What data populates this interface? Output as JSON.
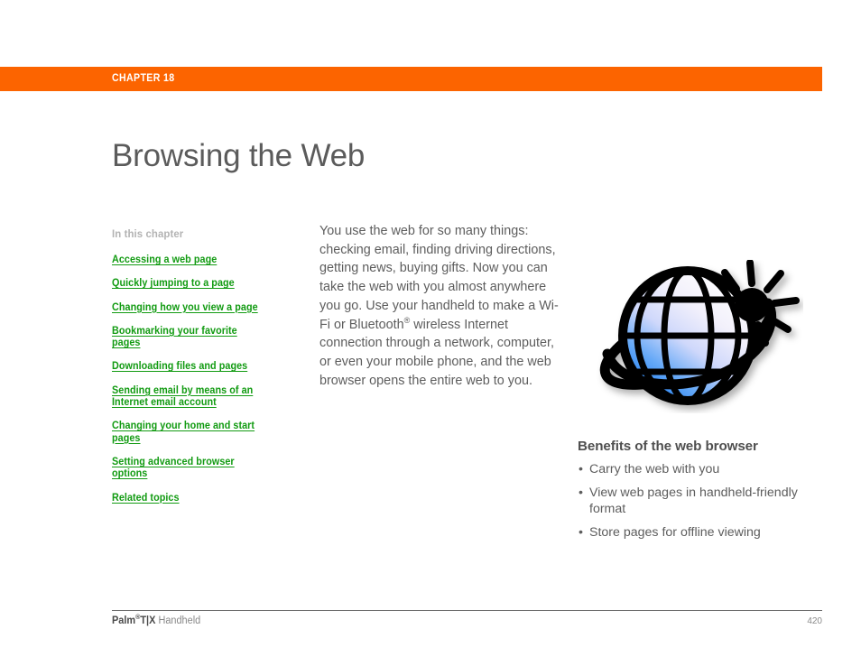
{
  "chapter": {
    "band_color": "#fc6400",
    "label": "CHAPTER 18"
  },
  "title": "Browsing the Web",
  "sidebar": {
    "heading": "In this chapter",
    "link_color": "#129b12",
    "links": [
      "Accessing a web page",
      "Quickly jumping to a page",
      "Changing how you view a page",
      "Bookmarking your favorite pages",
      "Downloading files and pages",
      "Sending email by means of an Internet email account",
      "Changing your home and start pages",
      "Setting advanced browser options",
      "Related topics"
    ]
  },
  "body": {
    "paragraph_part1": "You use the web for so many things: checking email, finding driving directions, getting news, buying gifts. Now you can take the web with you almost anywhere you go. Use your handheld to make a Wi-Fi or Bluetooth",
    "registered_mark": "®",
    "paragraph_part2": " wireless Internet connection through a network, computer, or even your mobile phone, and the web browser opens the entire web to you."
  },
  "illustration": {
    "name": "globe-with-sparkle",
    "globe_blue": "#2e8bf5",
    "globe_light": "#eceaf7",
    "outline": "#000000"
  },
  "benefits": {
    "title": "Benefits of the web browser",
    "items": [
      "Carry the web with you",
      "View web pages in handheld-friendly format",
      "Store pages for offline viewing"
    ]
  },
  "footer": {
    "brand": "Palm",
    "registered_mark": "®",
    "model": "T|X",
    "product": " Handheld",
    "page_number": "420"
  }
}
